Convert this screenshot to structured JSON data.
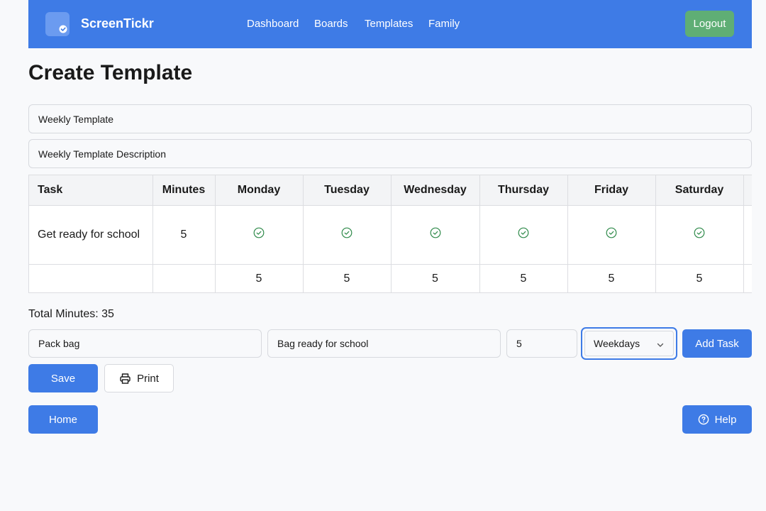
{
  "nav": {
    "brand": "ScreenTickr",
    "links": [
      "Dashboard",
      "Boards",
      "Templates",
      "Family"
    ],
    "logout": "Logout"
  },
  "page": {
    "title": "Create Template"
  },
  "form": {
    "name_value": "Weekly Template",
    "description_value": "Weekly Template Description"
  },
  "table": {
    "headers": [
      "Task",
      "Minutes",
      "Monday",
      "Tuesday",
      "Wednesday",
      "Thursday",
      "Friday",
      "Saturday"
    ],
    "rows": [
      {
        "task": "Get ready for school",
        "minutes": "5"
      }
    ],
    "totals": [
      "5",
      "5",
      "5",
      "5",
      "5",
      "5"
    ]
  },
  "summary": {
    "total_minutes": "Total Minutes: 35"
  },
  "new_task": {
    "name_value": "Pack bag",
    "description_value": "Bag ready for school",
    "minutes_value": "5",
    "schedule_value": "Weekdays",
    "add_label": "Add Task"
  },
  "actions": {
    "save": "Save",
    "print": "Print",
    "home": "Home",
    "help": "Help"
  },
  "colors": {
    "primary": "#3e7be6",
    "success": "#5fae75",
    "check": "#2f8a4a"
  }
}
